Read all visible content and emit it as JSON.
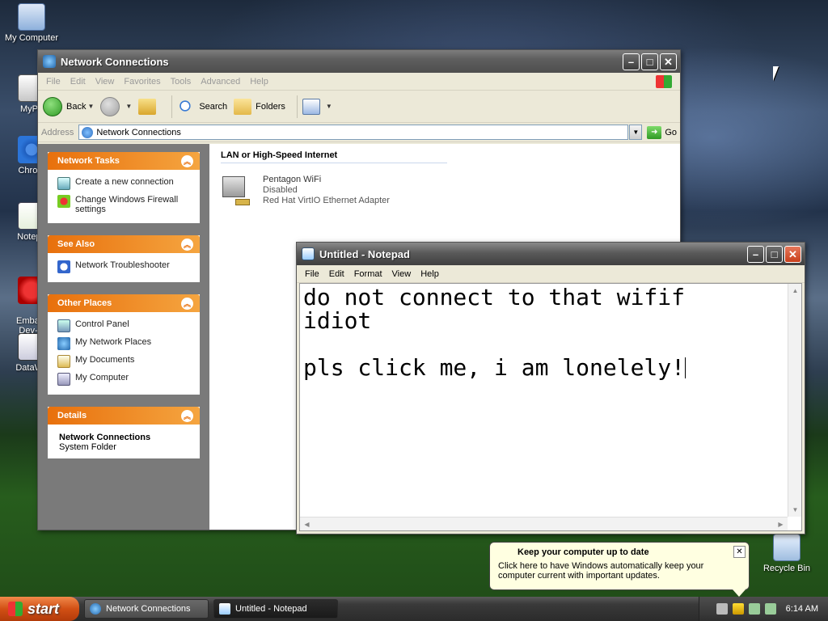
{
  "desktop": {
    "icons": [
      {
        "label": "My Computer"
      },
      {
        "label": "MyPa"
      },
      {
        "label": "Chrom"
      },
      {
        "label": "Notepa"
      },
      {
        "label": "Embarc\nDev-C"
      },
      {
        "label": "DataWa"
      },
      {
        "label": "Recycle Bin"
      }
    ]
  },
  "explorer": {
    "title": "Network Connections",
    "menu": [
      "File",
      "Edit",
      "View",
      "Favorites",
      "Tools",
      "Advanced",
      "Help"
    ],
    "toolbar": {
      "back": "Back",
      "search": "Search",
      "folders": "Folders"
    },
    "address": {
      "label": "Address",
      "value": "Network Connections",
      "go": "Go"
    },
    "taskpane": {
      "network_tasks": {
        "title": "Network Tasks",
        "items": [
          "Create a new connection",
          "Change Windows Firewall settings"
        ]
      },
      "see_also": {
        "title": "See Also",
        "items": [
          "Network Troubleshooter"
        ]
      },
      "other_places": {
        "title": "Other Places",
        "items": [
          "Control Panel",
          "My Network Places",
          "My Documents",
          "My Computer"
        ]
      },
      "details": {
        "title": "Details",
        "name": "Network Connections",
        "type": "System Folder"
      }
    },
    "group_header": "LAN or High-Speed Internet",
    "connection": {
      "name": "Pentagon WiFi",
      "status": "Disabled",
      "adapter": "Red Hat VirtIO Ethernet Adapter"
    }
  },
  "notepad": {
    "title": "Untitled - Notepad",
    "menu": [
      "File",
      "Edit",
      "Format",
      "View",
      "Help"
    ],
    "text": "do not connect to that wifif\nidiot\n\npls click me, i am lonelely!"
  },
  "balloon": {
    "title": "Keep your computer up to date",
    "body": "Click here to have Windows automatically keep your computer current with important updates."
  },
  "taskbar": {
    "start": "start",
    "tasks": [
      "Network Connections",
      "Untitled - Notepad"
    ],
    "clock": "6:14 AM"
  }
}
